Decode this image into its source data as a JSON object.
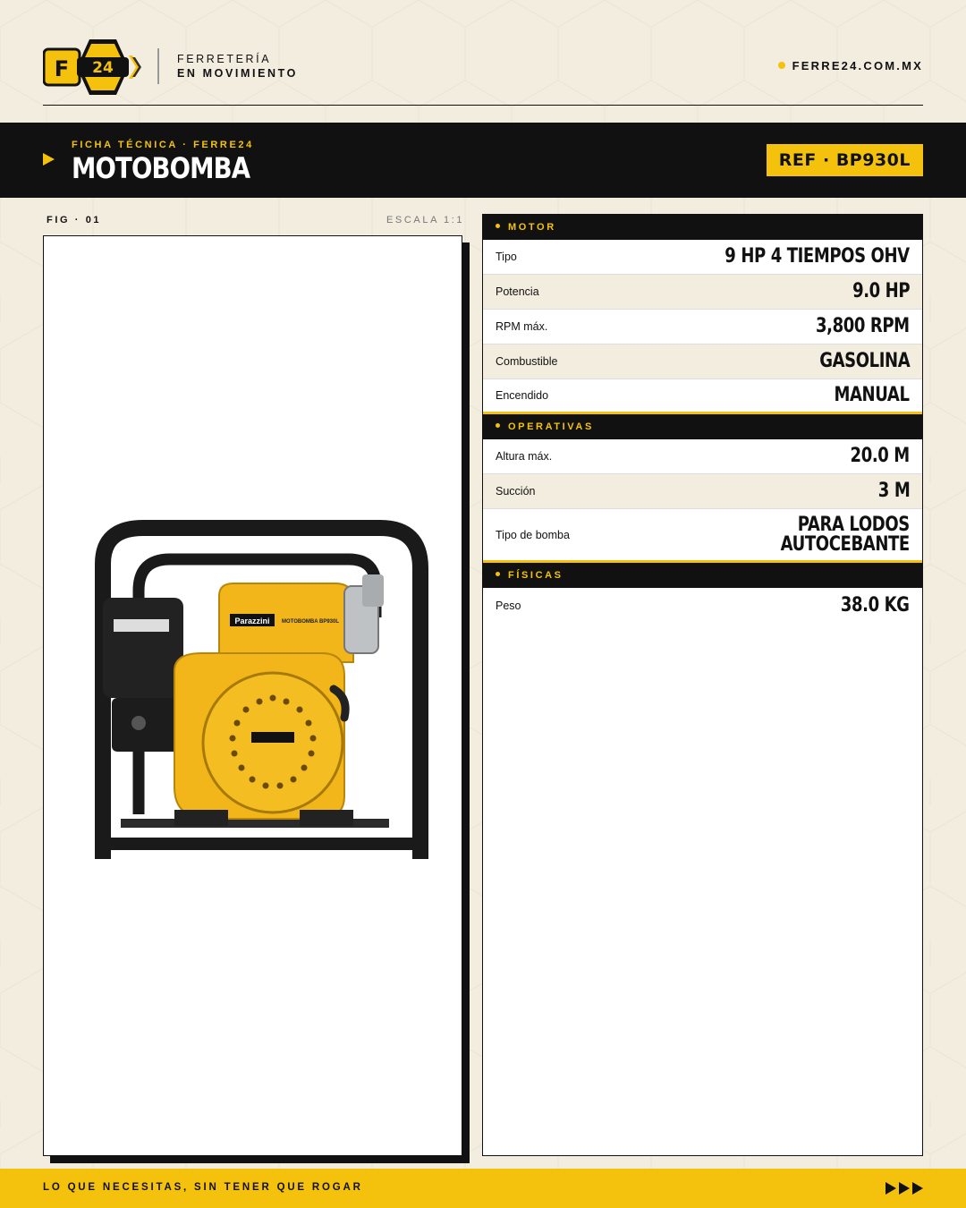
{
  "brand": {
    "logo_letter": "F",
    "logo_number": "24",
    "tagline_line1": "FERRETERÍA",
    "tagline_line2": "EN MOVIMIENTO",
    "website": "FERRE24.COM.MX",
    "accent_color": "#f4c20d",
    "dark_color": "#111111",
    "background_color": "#f3ede0"
  },
  "banner": {
    "kicker": "FICHA TÉCNICA · FERRE24",
    "title": "MOTOBOMBA",
    "ref": "REF · BP930L"
  },
  "figure": {
    "label": "FIG · 01",
    "scale": "ESCALA 1:1",
    "product_brand": "Parazzini",
    "product_model": "MOTOBOMBA BP930L"
  },
  "specs": {
    "motor": {
      "title": "MOTOR",
      "rows": [
        {
          "label": "Tipo",
          "value": "9 HP 4 TIEMPOS OHV"
        },
        {
          "label": "Potencia",
          "value": "9.0 HP"
        },
        {
          "label": "RPM máx.",
          "value": "3,800 RPM"
        },
        {
          "label": "Combustible",
          "value": "GASOLINA"
        },
        {
          "label": "Encendido",
          "value": "MANUAL"
        }
      ]
    },
    "operativas": {
      "title": "OPERATIVAS",
      "rows": [
        {
          "label": "Altura máx.",
          "value": "20.0 M"
        },
        {
          "label": "Succión",
          "value": "3 M"
        },
        {
          "label": "Tipo de bomba",
          "value_line1": "PARA LODOS",
          "value_line2": "AUTOCEBANTE"
        }
      ]
    },
    "fisicas": {
      "title": "FÍSICAS",
      "rows": [
        {
          "label": "Peso",
          "value": "38.0 KG"
        }
      ]
    }
  },
  "footer": {
    "slogan": "LO QUE NECESITAS, SIN TENER QUE ROGAR",
    "arrows_icon": "triple-play-arrows"
  }
}
